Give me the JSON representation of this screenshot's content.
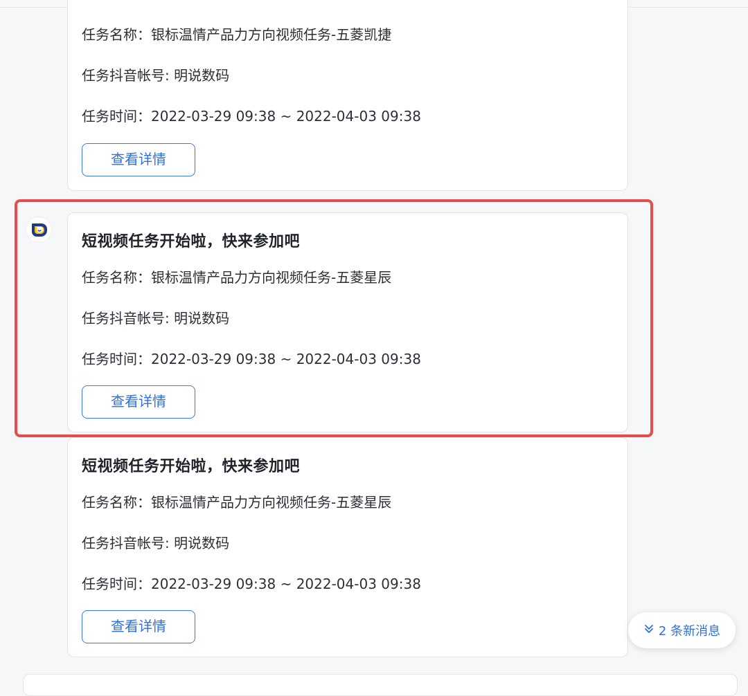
{
  "messages": [
    {
      "title": "",
      "task_name": "任务名称：银标温情产品力方向视频任务-五菱凯捷",
      "account": "任务抖音帐号: 明说数码",
      "time": "任务时间：2022-03-29 09:38 ~ 2022-04-03 09:38",
      "button": "查看详情"
    },
    {
      "title": "短视频任务开始啦，快来参加吧",
      "task_name": "任务名称：银标温情产品力方向视频任务-五菱星辰",
      "account": "任务抖音帐号: 明说数码",
      "time": "任务时间：2022-03-29 09:38 ~ 2022-04-03 09:38",
      "button": "查看详情"
    },
    {
      "title": "短视频任务开始啦，快来参加吧",
      "task_name": "任务名称：银标温情产品力方向视频任务-五菱星辰",
      "account": "任务抖音帐号: 明说数码",
      "time": "任务时间：2022-03-29 09:38 ~ 2022-04-03 09:38",
      "button": "查看详情"
    }
  ],
  "new_messages": {
    "icon": "double-chevron-down-icon",
    "label": "2 条新消息"
  },
  "colors": {
    "accent": "#2f6fe0",
    "highlight": "#e84b4b",
    "avatar": "#1f3a8a",
    "avatar_accent": "#f5c518"
  }
}
